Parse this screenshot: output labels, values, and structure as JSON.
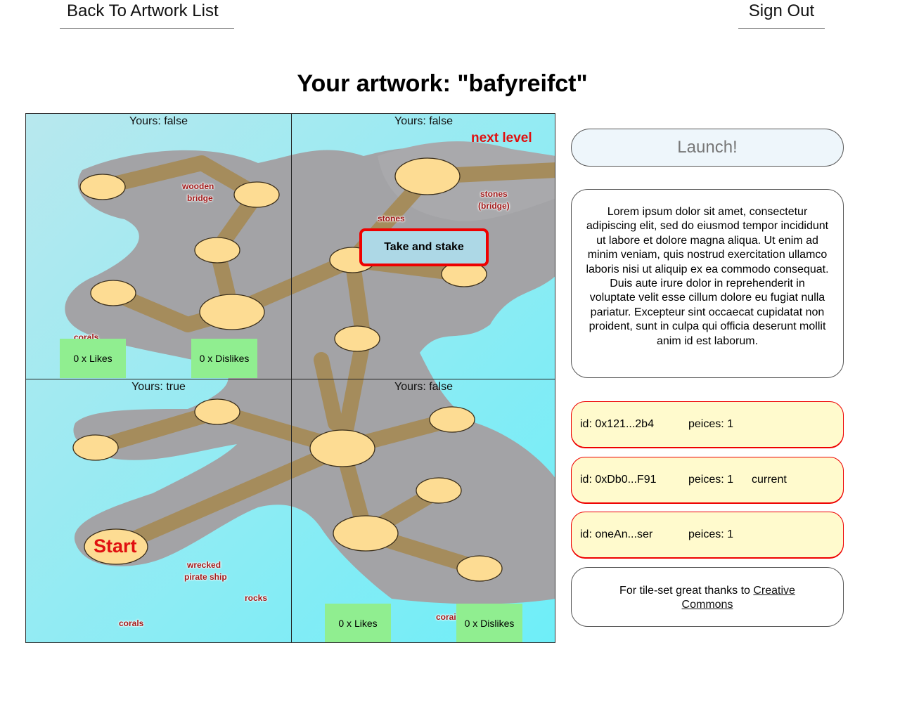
{
  "header": {
    "back_label": "Back To Artwork List",
    "signout_label": "Sign Out"
  },
  "title": "Your artwork: \"bafyreifct\"",
  "map": {
    "tiles": [
      {
        "yours_label": "Yours: false",
        "likes": "0 x Likes",
        "dislikes": "0 x Dislikes"
      },
      {
        "yours_label": "Yours: false"
      },
      {
        "yours_label": "Yours: true"
      },
      {
        "yours_label": "Yours: false",
        "likes": "0 x Likes",
        "dislikes": "0 x Dislikes"
      }
    ],
    "take_and_stake_label": "Take and stake",
    "next_level_label": "next level",
    "start_label": "Start",
    "labels": {
      "wooden": "wooden",
      "bridge": "bridge",
      "stones1": "stones",
      "stones2": "stones",
      "bridge2": "(bridge)",
      "corals1": "corals",
      "corals2": "corals",
      "corals3": "corai",
      "wrecked": "wrecked",
      "pirate_ship": "pirate ship",
      "rocks": "rocks"
    },
    "colors": {
      "water": "#b0eaf0",
      "land": "#a3a3a6",
      "path": "#a58c5c",
      "node": "#fddc93"
    }
  },
  "sidebar": {
    "launch_label": "Launch!",
    "description": "Lorem ipsum dolor sit amet, consectetur adipiscing elit, sed do eiusmod tempor incididunt ut labore et dolore magna aliqua. Ut enim ad minim veniam, quis nostrud exercitation ullamco laboris nisi ut aliquip ex ea commodo consequat. Duis aute irure dolor in reprehenderit in voluptate velit esse cillum dolore eu fugiat nulla pariatur. Excepteur sint occaecat cupidatat non proident, sunt in culpa qui officia deserunt mollit anim id est laborum.",
    "players": [
      {
        "id": "id: 0x121...2b4",
        "pieces": "peices: 1",
        "status": ""
      },
      {
        "id": "id: 0xDb0...F91",
        "pieces": "peices: 1",
        "status": "current"
      },
      {
        "id": "id: oneAn...ser",
        "pieces": "peices: 1",
        "status": ""
      }
    ],
    "credits_text": "For tile-set great thanks to ",
    "credits_link": "Creative Commons"
  }
}
